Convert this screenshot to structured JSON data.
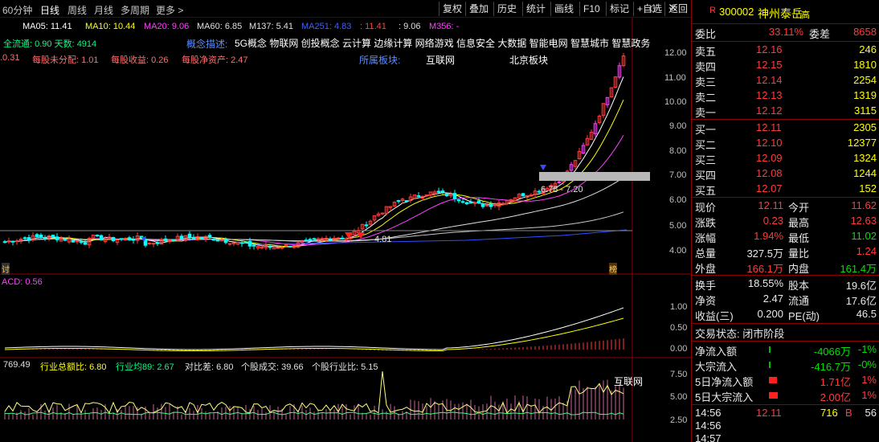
{
  "toolbar": {
    "periods": [
      "60分钟",
      "日线",
      "周线",
      "月线",
      "多周期",
      "更多 >"
    ],
    "buttons": [
      "复权",
      "叠加",
      "历史",
      "统计",
      "画线",
      "F10",
      "标记",
      "+自选",
      "返回"
    ]
  },
  "main_chart": {
    "ma_legend": [
      {
        "label": "MA05: 11.41",
        "color": "#ffffff"
      },
      {
        "label": "MA10: 10.44",
        "color": "#ffff00"
      },
      {
        "label": "MA20: 9.06",
        "color": "#ff40ff"
      },
      {
        "label": "MA60: 6.85",
        "color": "#e0e0e0"
      },
      {
        "label": "M137: 5.41",
        "color": "#e0e0e0"
      },
      {
        "label": "MA251: 4.83",
        "color": "#4060ff"
      },
      {
        "label": ": 11.41",
        "color": "#ff4040"
      },
      {
        "label": ": 9.06",
        "color": "#e0e0e0"
      },
      {
        "label": "M356: -",
        "color": "#ff40ff"
      }
    ],
    "info_row1": {
      "float": "全流通: 0.90 天数: 4914",
      "concept_label": "概念描述:",
      "concepts": "5G概念 物联网 创投概念 云计算 边缘计算 网络游戏 信息安全 大数据 智能电网 智慧城市 智慧政务"
    },
    "info_row2": {
      "items": [
        ".0.31",
        "每股未分配: 1.01",
        "每股收益: 0.26",
        "每股净资产: 2.47"
      ],
      "sector_label": "所属板块:",
      "sectors": [
        "互联网",
        "北京板块"
      ]
    },
    "range_label": "6.78 - 7.20",
    "low_label": "4.81",
    "left_marker": "讨",
    "right_marker": "榜",
    "y_ticks": [
      "12.00",
      "11.00",
      "10.00",
      "9.00",
      "8.00",
      "7.00",
      "6.00",
      "5.00",
      "4.00"
    ]
  },
  "macd_panel": {
    "label": "ACD: 0.56",
    "y_ticks": [
      "1.00",
      "0.50",
      "0.00"
    ]
  },
  "flow_panel": {
    "items": [
      {
        "label": "769.49",
        "color": "#e0e0e0"
      },
      {
        "label": "行业总额比: 6.80",
        "color": "#ffff00"
      },
      {
        "label": "行业均89: 2.67",
        "color": "#00ff80"
      },
      {
        "label": "对比差: 6.80",
        "color": "#e0e0e0"
      },
      {
        "label": "个股成交: 39.66",
        "color": "#e0e0e0"
      },
      {
        "label": "个股行业比: 5.15",
        "color": "#e0e0e0"
      }
    ],
    "tag": "互联网",
    "y_ticks": [
      "7.50",
      "5.00",
      "2.50"
    ]
  },
  "panel": {
    "code": "300002",
    "name": "神州泰岳",
    "badge": "高",
    "ratio": {
      "label1": "委比",
      "value1": "33.11%",
      "label2": "委差",
      "value2": "8658"
    },
    "asks": [
      {
        "label": "卖五",
        "price": "12.16",
        "vol": "246"
      },
      {
        "label": "卖四",
        "price": "12.15",
        "vol": "1810"
      },
      {
        "label": "卖三",
        "price": "12.14",
        "vol": "2254"
      },
      {
        "label": "卖二",
        "price": "12.13",
        "vol": "1319"
      },
      {
        "label": "卖一",
        "price": "12.12",
        "vol": "3115"
      }
    ],
    "bids": [
      {
        "label": "买一",
        "price": "12.11",
        "vol": "2305"
      },
      {
        "label": "买二",
        "price": "12.10",
        "vol": "12377"
      },
      {
        "label": "买三",
        "price": "12.09",
        "vol": "1324"
      },
      {
        "label": "买四",
        "price": "12.08",
        "vol": "1244"
      },
      {
        "label": "买五",
        "price": "12.07",
        "vol": "152"
      }
    ],
    "stats": [
      {
        "l1": "现价",
        "v1": "12.11",
        "c1": "red",
        "l2": "今开",
        "v2": "11.62",
        "c2": "red"
      },
      {
        "l1": "涨跌",
        "v1": "0.23",
        "c1": "red",
        "l2": "最高",
        "v2": "12.63",
        "c2": "red"
      },
      {
        "l1": "涨幅",
        "v1": "1.94%",
        "c1": "red",
        "l2": "最低",
        "v2": "11.02",
        "c2": "green"
      },
      {
        "l1": "总量",
        "v1": "327.5万",
        "c1": "white",
        "l2": "量比",
        "v2": "1.24",
        "c2": "red"
      },
      {
        "l1": "外盘",
        "v1": "166.1万",
        "c1": "red",
        "l2": "内盘",
        "v2": "161.4万",
        "c2": "green"
      }
    ],
    "stats2": [
      {
        "l1": "换手",
        "v1": "18.55%",
        "l2": "股本",
        "v2": "19.6亿"
      },
      {
        "l1": "净资",
        "v1": "2.47",
        "l2": "流通",
        "v2": "17.6亿"
      },
      {
        "l1": "收益(三)",
        "v1": "0.200",
        "l2": "PE(动)",
        "v2": "46.5"
      }
    ],
    "trade_state": "交易状态: 闭市阶段",
    "flows": [
      {
        "label": "净流入额",
        "value": "-4066万",
        "pct": "-1%",
        "color": "green",
        "bar": 0.02
      },
      {
        "label": "大宗流入",
        "value": "-416.7万",
        "pct": "-0%",
        "color": "green",
        "bar": 0.02
      },
      {
        "label": "5日净流入额",
        "value": "1.71亿",
        "pct": "1%",
        "color": "red",
        "bar": 0.6
      },
      {
        "label": "5日大宗流入",
        "value": "2.00亿",
        "pct": "1%",
        "color": "red",
        "bar": 0.7
      }
    ],
    "ticks": [
      {
        "time": "14:56",
        "price": "12.11",
        "vol": "716",
        "side": "B",
        "num": "56"
      },
      {
        "time": "14:56",
        "price": "",
        "vol": "",
        "side": "",
        "num": ""
      },
      {
        "time": "14:57",
        "price": "",
        "vol": "",
        "side": "",
        "num": ""
      }
    ]
  }
}
